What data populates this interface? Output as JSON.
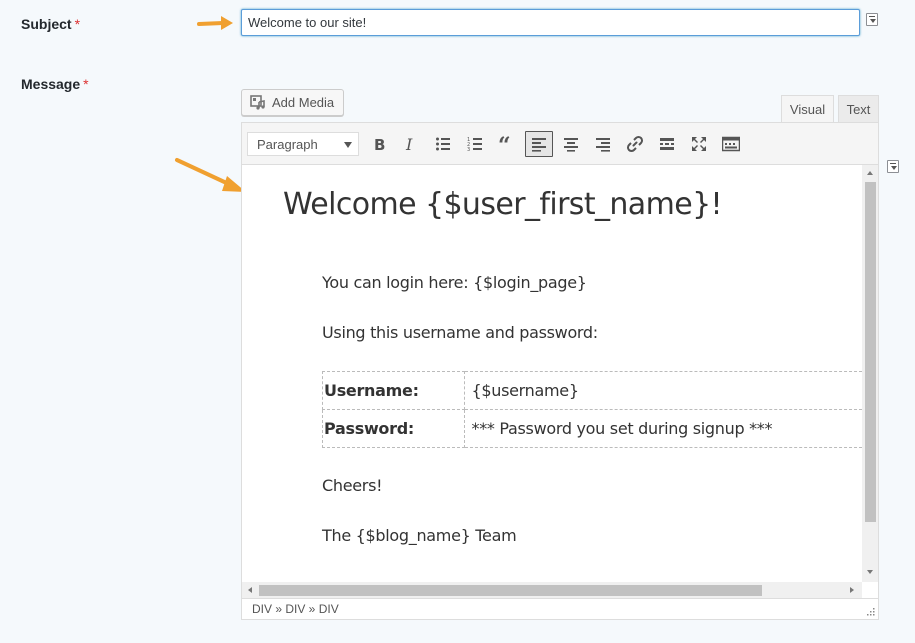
{
  "subject": {
    "label": "Subject",
    "required_mark": "*",
    "value": "Welcome to our site!"
  },
  "message": {
    "label": "Message",
    "required_mark": "*"
  },
  "editor": {
    "add_media_label": "Add Media",
    "tabs": {
      "visual": "Visual",
      "text": "Text"
    },
    "format_select": "Paragraph",
    "toolbar_icons": [
      "bold-icon",
      "italic-icon",
      "bullet-list-icon",
      "numbered-list-icon",
      "blockquote-icon",
      "align-left-icon",
      "align-center-icon",
      "align-right-icon",
      "link-icon",
      "read-more-icon",
      "fullscreen-icon",
      "toolbar-toggle-icon"
    ],
    "content": {
      "heading": "Welcome {$user_first_name}!",
      "login_line": "You can login here: {$login_page}",
      "using_line": "Using this username and password:",
      "table": [
        {
          "key": "Username:",
          "value": "{$username}"
        },
        {
          "key": "Password:",
          "value": "*** Password you set during signup ***"
        }
      ],
      "cheers": "Cheers!",
      "team": "The {$blog_name} Team"
    },
    "status_path": "DIV » DIV » DIV"
  },
  "colors": {
    "arrow": "#f0a030",
    "required": "#dc3232",
    "focus_border": "#5b9dd9"
  }
}
